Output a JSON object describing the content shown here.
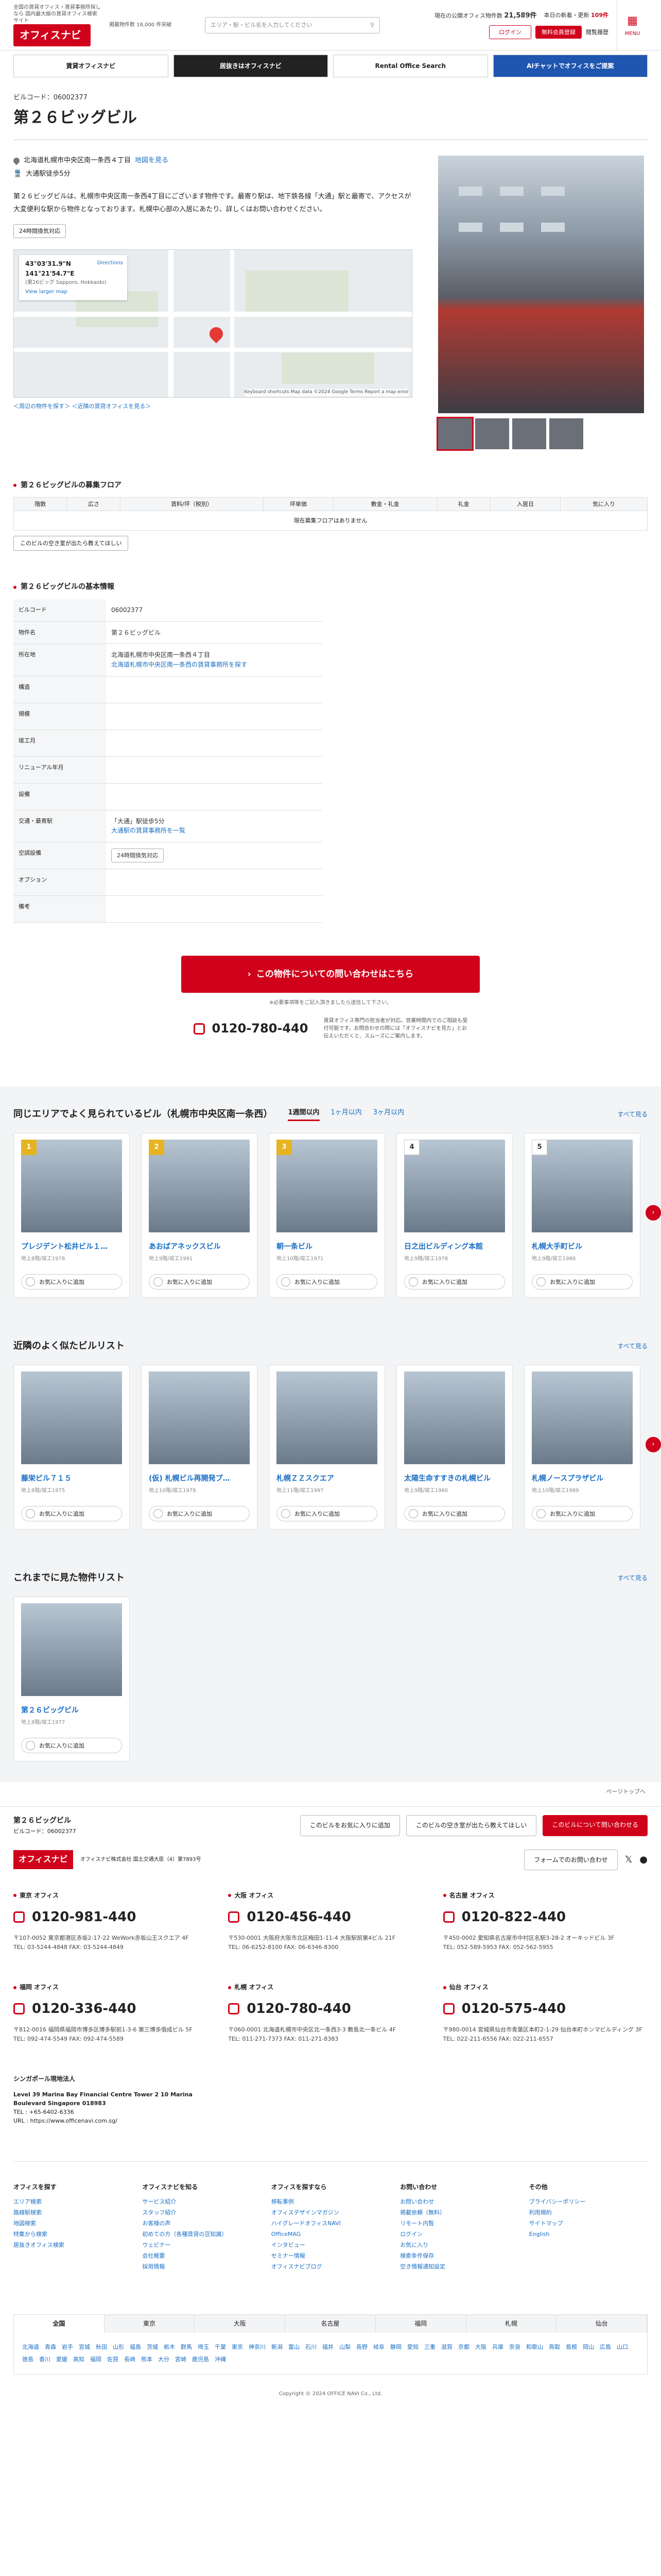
{
  "header": {
    "tagline": "全国の賃貸オフィス・賃貸事務所探しなら 国内最大級の賃貸オフィス検索サイト",
    "listing_count": "掲載物件数 18,000 件突破",
    "logo": "オフィスナビ",
    "search_placeholder": "エリア・駅・ビル名を入力してください",
    "stats_label": "現在の公開オフィス物件数",
    "stats_count": "21,589件",
    "today_label": "本日の新着・更新",
    "today_count": "109件",
    "login": "ログイン",
    "free_register": "無料会員登録",
    "history": "閲覧履歴",
    "menu": "MENU"
  },
  "banners": [
    "賃貸オフィスナビ",
    "居抜きはオフィスナビ",
    "Rental Office Search",
    "AIチャットでオフィスをご提案"
  ],
  "building": {
    "code": "ビルコード：06002377",
    "name": "第２６ビッグビル",
    "address": "北海道札幌市中央区南一条西４丁目",
    "map_link": "地図を見る",
    "station": "大通駅徒歩5分",
    "description": "第２６ビッグビルは、札幌市中央区南一条西4丁目にございます物件です。最寄り駅は、地下鉄各線「大通」駅と最寄で、アクセスが大変便利な駅から物件となっております。札幌中心部の入居にあたり、詳しくはお問い合わせください。",
    "route_btn": "24時間換気対応",
    "map_coords": "43°03'31.9\"N 141°21'54.7\"E",
    "map_place": "(第26ビッグ Sapporo, Hokkaido)",
    "map_larger": "View larger map",
    "map_directions": "Directions",
    "map_footer": "Keyboard shortcuts  Map data ©2024 Google  Terms  Report a map error",
    "map_links": "＜周辺の物件を探す＞  ＜近隣の賃貸オフィスを見る＞"
  },
  "floors": {
    "heading": "第２６ビッグビルの募集フロア",
    "columns": [
      "階数",
      "広さ",
      "賃料/坪（税別）",
      "坪単価",
      "敷金・礼金",
      "礼金",
      "入居日",
      "気に入り"
    ],
    "empty": "現在募集フロアはありません",
    "notify_btn": "このビルの空き室が出たら教えてほしい"
  },
  "info": {
    "heading": "第２６ビッグビルの基本情報",
    "rows": [
      {
        "k": "ビルコード",
        "v": "06002377"
      },
      {
        "k": "物件名",
        "v": "第２６ビッグビル"
      },
      {
        "k": "所在地",
        "v": "北海道札幌市中央区南一条西４丁目",
        "v2": "北海道札幌市中央区南一条西の賃貸事務所を探す"
      },
      {
        "k": "構造",
        "v": ""
      },
      {
        "k": "規模",
        "v": ""
      },
      {
        "k": "竣工月",
        "v": ""
      },
      {
        "k": "リニューアル年月",
        "v": ""
      },
      {
        "k": "設備",
        "v": ""
      },
      {
        "k": "交通・最寄駅",
        "v": "「大通」駅徒歩5分",
        "v2": "大通駅の賃貸事務所を一覧"
      },
      {
        "k": "空調設備",
        "v": "24時間換気対応"
      },
      {
        "k": "オプション",
        "v": ""
      },
      {
        "k": "備考",
        "v": ""
      }
    ]
  },
  "contact": {
    "cta": "この物件についての問い合わせはこちら",
    "note": "※必要事項等をご記入頂きましたら送信して下さい。",
    "tel": "0120-780-440",
    "tel_note": "賃貸オフィス専門の担当者が対応。営業時間内でのご相談も受付可能です。お問合わせの際には「オフィスナビを見た」とお伝えいただくと、スムーズにご案内します。"
  },
  "similar": {
    "heading": "同じエリアでよく見られているビル（札幌市中央区南一条西）",
    "tabs": [
      "1週間以内",
      "1ヶ月以内",
      "3ヶ月以内"
    ],
    "more": "すべて見る",
    "cards": [
      {
        "rank": "1",
        "name": "プレジデント松井ビル１…",
        "meta": "地上8階/竣工1978"
      },
      {
        "rank": "2",
        "name": "あおばアネックスビル",
        "meta": "地上9階/竣工1991"
      },
      {
        "rank": "3",
        "name": "朝一条ビル",
        "meta": "地上10階/竣工1971"
      },
      {
        "rank": "4",
        "name": "日之出ビルディング本館",
        "meta": "地上9階/竣工1978"
      },
      {
        "rank": "5",
        "name": "札幌大手町ビル",
        "meta": "地上9階/竣工1988"
      }
    ],
    "fav": "お気に入りに追加"
  },
  "nearby": {
    "heading": "近隣のよく似たビルリスト",
    "more": "すべて見る",
    "cards": [
      {
        "name": "藤栄ビル７１５",
        "meta": "地上8階/竣工1975"
      },
      {
        "name": "(仮) 札幌ビル再開発プ…",
        "meta": "地上10階/竣工1978"
      },
      {
        "name": "札幌ＺＺスクエア",
        "meta": "地上11階/竣工1997"
      },
      {
        "name": "太陽生命すすきの札幌ビル",
        "meta": "地上9階/竣工1980"
      },
      {
        "name": "札幌ノースプラザビル",
        "meta": "地上10階/竣工1989"
      }
    ]
  },
  "recent": {
    "heading": "これまでに見た物件リスト",
    "more": "すべて見る",
    "card": {
      "name": "第２６ビッグビル",
      "meta": "地上8階/竣工1977"
    }
  },
  "bar": {
    "top": "ページトップへ",
    "name": "第２６ビッグビル",
    "code": "ビルコード：06002377",
    "fav": "このビルをお気に入りに追加",
    "notify": "このビルの空き室が出たら教えてほしい",
    "inquire": "このビルについて問い合わせる"
  },
  "footer": {
    "logo": "オフィスナビ",
    "company": "オフィスナビ株式会社 国土交通大臣（4）第7893号",
    "form": "フォームでのお問い合わせ",
    "offices": [
      {
        "name": "東京 オフィス",
        "tel": "0120-981-440",
        "addr": "〒107-0052 東京都港区赤坂2-17-22 WeWork赤坂山王スクエア 4F",
        "fax": "TEL: 03-5244-4848 FAX: 03-5244-4849"
      },
      {
        "name": "大阪 オフィス",
        "tel": "0120-456-440",
        "addr": "〒530-0001 大阪府大阪市北区梅田1-11-4 大阪駅前第4ビル 21F",
        "fax": "TEL: 06-6252-8100 FAX: 06-6346-8300"
      },
      {
        "name": "名古屋 オフィス",
        "tel": "0120-822-440",
        "addr": "〒450-0002 愛知県名古屋市中村区名駅3-28-2 オーキッドビル 3F",
        "fax": "TEL: 052-589-5953 FAX: 052-562-5955"
      },
      {
        "name": "福岡 オフィス",
        "tel": "0120-336-440",
        "addr": "〒812-0016 福岡県福岡市博多区博多駅前1-3-6 第三博多偕成ビル 5F",
        "fax": "TEL: 092-474-5549 FAX: 092-474-5589"
      },
      {
        "name": "札幌 オフィス",
        "tel": "0120-780-440",
        "addr": "〒060-0001 北海道札幌市中央区北一条西3-3 敷島北一条ビル 4F",
        "fax": "TEL: 011-271-7373 FAX: 011-271-8383"
      },
      {
        "name": "仙台 オフィス",
        "tel": "0120-575-440",
        "addr": "〒980-0014 宮城県仙台市青葉区本町2-1-29 仙台本町ホンマビルディング 3F",
        "fax": "TEL: 022-211-6556 FAX: 022-211-6557"
      }
    ],
    "sg_name": "シンガポール現地法人",
    "sg_addr": "Level 39 Marina Bay Financial Centre Tower 2 10 Marina Boulevard Singapore 018983",
    "sg_tel": "TEL : +65-6402-6336",
    "sg_url": "URL : https://www.officenavi.com.sg/",
    "link_cols": [
      {
        "h": "オフィスを探す",
        "items": [
          "エリア検索",
          "路線駅検索",
          "地図検索",
          "特集から検索",
          "居抜きオフィス検索"
        ]
      },
      {
        "h": "オフィスナビを知る",
        "items": [
          "サービス紹介",
          "スタッフ紹介",
          "お客様の声",
          "初めての方（各種賃貸の豆知識）",
          "ウェビナー",
          "会社概要",
          "採用情報"
        ]
      },
      {
        "h": "オフィスを探すなら",
        "items": [
          "移転事例",
          "オフィスデザインマガジン",
          "ハイグレードオフィスNAVI",
          "OfficeMAG",
          "インタビュー",
          "セミナー情報",
          "オフィスナビブログ"
        ]
      },
      {
        "h": "お問い合わせ",
        "items": [
          "お問い合わせ",
          "掲載依頼（無料）",
          "リモート内覧",
          "ログイン",
          "お気に入り",
          "検索条件保存",
          "空き情報通知設定"
        ]
      },
      {
        "h": "その他",
        "items": [
          "プライバシーポリシー",
          "利用規約",
          "サイトマップ",
          "English"
        ]
      }
    ],
    "area_tabs": [
      "全国",
      "東京",
      "大阪",
      "名古屋",
      "福岡",
      "札幌",
      "仙台"
    ],
    "area_links": "北海道　青森　岩手　宮城　秋田　山形　福島　茨城　栃木　群馬　埼玉　千葉　東京　神奈川　新潟　富山　石川　福井　山梨　長野　岐阜　静岡　愛知　三重　滋賀　京都　大阪　兵庫　奈良　和歌山　鳥取　島根　岡山　広島　山口　徳島　香川　愛媛　高知　福岡　佐賀　長崎　熊本　大分　宮崎　鹿児島　沖縄",
    "copyright": "Copyright © 2024 OFFICE NAVI Co., Ltd."
  }
}
